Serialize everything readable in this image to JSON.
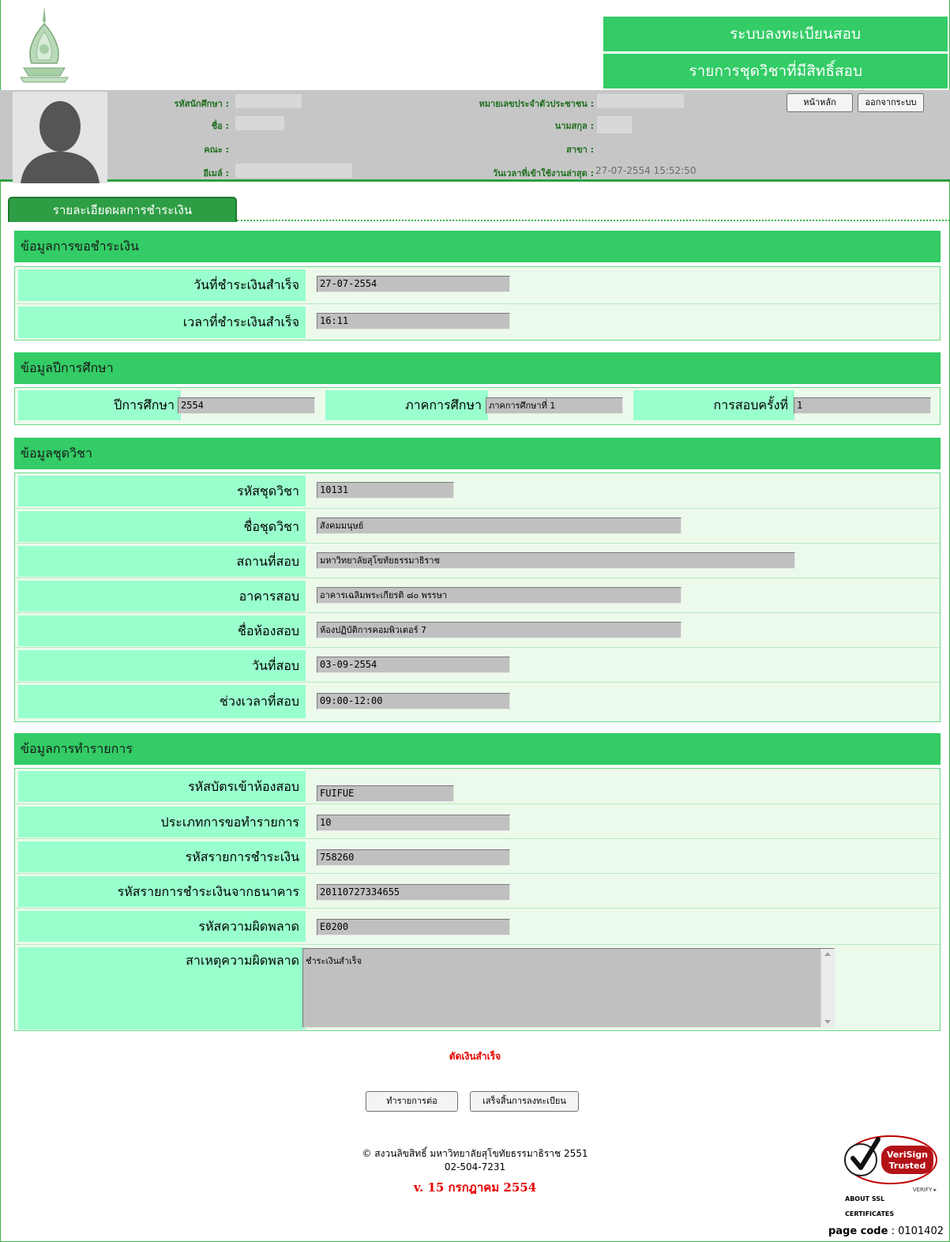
{
  "header": {
    "system_title": "ระบบลงทะเบียนสอบ",
    "page_title": "รายการชุดวิชาที่มีสิทธิ์สอบ",
    "home_button": "หน้าหลัก",
    "logout_button": "ออกจากระบบ"
  },
  "profile": {
    "student_id_label": "รหัสนักศึกษา :",
    "name_label": "ชื่อ :",
    "faculty_label": "คณะ :",
    "email_label": "อีเมล์ :",
    "citizen_id_label": "หมายเลขประจำตัวประชาชน :",
    "surname_label": "นามสกุล :",
    "major_label": "สาขา :",
    "last_login_label": "วันเวลาที่เข้าใช้งานล่าสุด :",
    "last_login_value": "27-07-2554 15:52:50"
  },
  "tab": {
    "label": "รายละเอียดผลการชำระเงิน"
  },
  "payment_info": {
    "title": "ข้อมูลการขอชำระเงิน",
    "rows": [
      {
        "label": "วันที่ชำระเงินสำเร็จ",
        "value": "27-07-2554"
      },
      {
        "label": "เวลาที่ชำระเงินสำเร็จ",
        "value": "16:11"
      }
    ]
  },
  "academic_info": {
    "title": "ข้อมูลปีการศึกษา",
    "year_label": "ปีการศึกษา",
    "year_value": "2554",
    "semester_label": "ภาคการศึกษา",
    "semester_value": "ภาคการศึกษาที่ 1",
    "exam_round_label": "การสอบครั้งที่",
    "exam_round_value": "1"
  },
  "course_info": {
    "title": "ข้อมูลชุดวิชา",
    "rows": [
      {
        "label": "รหัสชุดวิชา",
        "value": "10131"
      },
      {
        "label": "ชื่อชุดวิชา",
        "value": "สังคมมนุษย์"
      },
      {
        "label": "สถานที่สอบ",
        "value": "มหาวิทยาลัยสุโขทัยธรรมาธิราช"
      },
      {
        "label": "อาคารสอบ",
        "value": "อาคารเฉลิมพระเกียรติ ๘๐ พรรษา"
      },
      {
        "label": "ชื่อห้องสอบ",
        "value": "ห้องปฏิบัติการคอมพิวเตอร์ 7"
      },
      {
        "label": "วันที่สอบ",
        "value": "03-09-2554"
      },
      {
        "label": "ช่วงเวลาที่สอบ",
        "value": "09:00-12:00"
      }
    ]
  },
  "transaction_info": {
    "title": "ข้อมูลการทำรายการ",
    "rows": [
      {
        "label": "รหัสบัตรเข้าห้องสอบ",
        "value": "FUIFUE"
      },
      {
        "label": "ประเภทการขอทำรายการ",
        "value": "10"
      },
      {
        "label": "รหัสรายการชำระเงิน",
        "value": "758260"
      },
      {
        "label": "รหัสรายการชำระเงินจากธนาคาร",
        "value": "20110727334655"
      },
      {
        "label": "รหัสความผิดพลาด",
        "value": "E0200"
      }
    ],
    "error_reason_label": "สาเหตุความผิดพลาด",
    "error_reason_value": "ชำระเงินสำเร็จ"
  },
  "result_message": "ตัดเงินสำเร็จ",
  "buttons": {
    "continue": "ทำรายการต่อ",
    "finish": "เสร็จสิ้นการลงทะเบียน"
  },
  "footer": {
    "copyright": "© สงวนลิขสิทธิ์ มหาวิทยาลัยสุโขทัยธรรมาธิราช 2551",
    "phone": "02-504-7231",
    "version": "v. 15 กรกฎาคม 2554",
    "verisign_line1": "VeriSign",
    "verisign_line2": "Trusted",
    "verisign_verify": "VERIFY ▸",
    "ssl_about_1": "ABOUT SSL",
    "ssl_about_2": "CERTIFICATES",
    "page_code_label": "page code",
    "page_code_value": ": 0101402"
  },
  "colors": {
    "accent_green": "#33cc66",
    "label_green": "#99ffcc",
    "error_red": "#e60000"
  }
}
